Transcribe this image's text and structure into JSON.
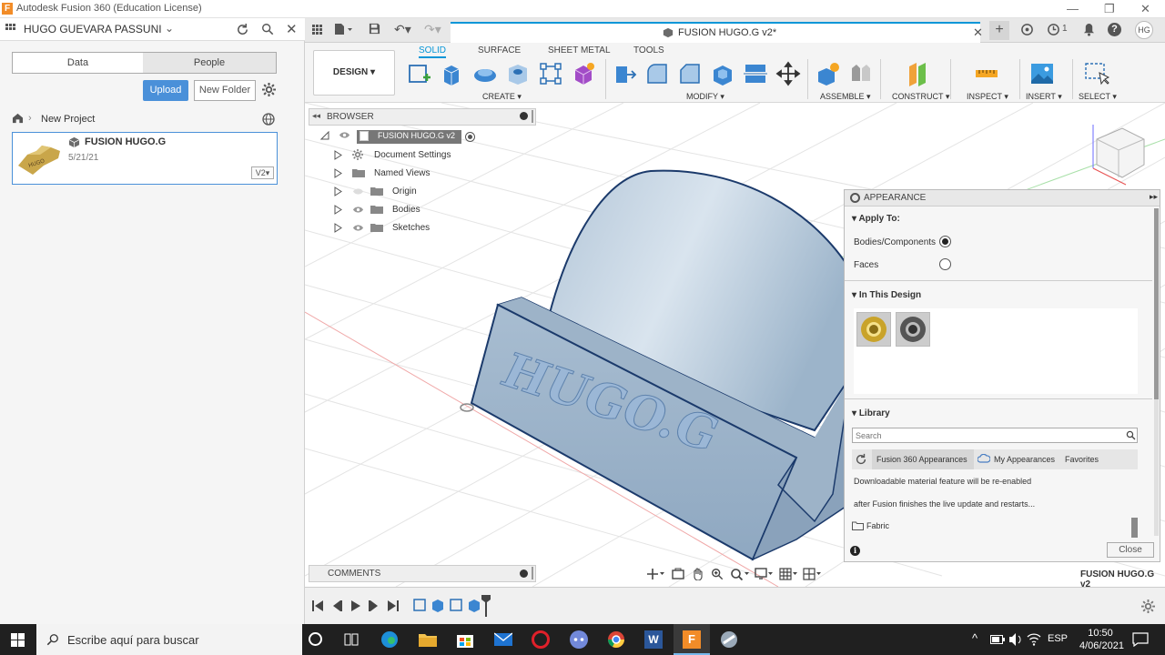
{
  "window": {
    "title": "Autodesk Fusion 360 (Education License)"
  },
  "left": {
    "user": "HUGO GUEVARA PASSUNI",
    "tab_data": "Data",
    "tab_people": "People",
    "upload": "Upload",
    "new_folder": "New Folder",
    "breadcrumb": "New Project",
    "item_title": "FUSION HUGO.G",
    "item_date": "5/21/21",
    "item_version": "V2"
  },
  "doc": {
    "tab_title": "FUSION HUGO.G v2*"
  },
  "toolbar": {
    "design": "DESIGN",
    "tabs": [
      "SOLID",
      "SURFACE",
      "SHEET METAL",
      "TOOLS"
    ],
    "groups": {
      "create": "CREATE",
      "modify": "MODIFY",
      "assemble": "ASSEMBLE",
      "construct": "CONSTRUCT",
      "inspect": "INSPECT",
      "insert": "INSERT",
      "select": "SELECT"
    },
    "notif_count": "1",
    "avatar": "HG"
  },
  "browser": {
    "title": "BROWSER",
    "root": "FUSION HUGO.G v2",
    "items": [
      "Document Settings",
      "Named Views",
      "Origin",
      "Bodies",
      "Sketches"
    ]
  },
  "model": {
    "text": "HUGO.G"
  },
  "appearance": {
    "title": "APPEARANCE",
    "apply_to": "Apply To:",
    "bodies": "Bodies/Components",
    "faces": "Faces",
    "in_design": "In This Design",
    "library": "Library",
    "search_placeholder": "Search",
    "lib_tab1": "Fusion 360 Appearances",
    "lib_tab2": "My Appearances",
    "lib_tab3": "Favorites",
    "msg1": "Downloadable material feature will be re-enabled",
    "msg2": "after Fusion finishes the live update and restarts...",
    "folder": "Fabric",
    "close": "Close"
  },
  "comments": {
    "title": "COMMENTS"
  },
  "status": {
    "doc_name": "FUSION HUGO.G v2"
  },
  "taskbar": {
    "search": "Escribe aquí para buscar",
    "lang": "ESP",
    "time": "10:50",
    "date": "4/06/2021"
  },
  "colors": {
    "accent": "#0696d7",
    "model": "#a9bfd4",
    "taskbar": "#202020"
  }
}
